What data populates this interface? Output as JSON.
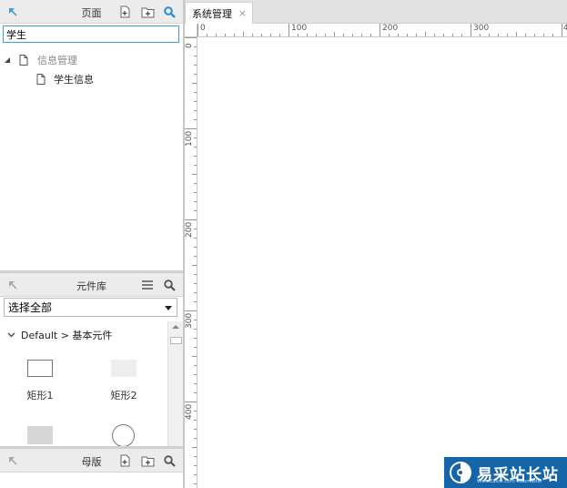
{
  "pages_panel": {
    "title": "页面",
    "search_value": "学生",
    "tree": [
      {
        "label": "信息管理",
        "type": "folder-page",
        "expanded": true
      },
      {
        "label": "学生信息",
        "type": "page"
      }
    ]
  },
  "library_panel": {
    "title": "元件库",
    "select_value": "选择全部",
    "group_label": "Default > 基本元件",
    "widgets": [
      {
        "label": "矩形1"
      },
      {
        "label": "矩形2"
      }
    ]
  },
  "masters_panel": {
    "title": "母版"
  },
  "tabs": [
    {
      "label": "系统管理",
      "close": "×"
    }
  ],
  "ruler": {
    "top": [
      "0",
      "100",
      "200",
      "300",
      "4"
    ],
    "left": [
      "0",
      "100",
      "200",
      "300",
      "400"
    ]
  },
  "watermark": {
    "text": "易采站长站",
    "sub": "Www.Easck.Com Webmaster"
  },
  "colors": {
    "accent": "#3b9ddd",
    "panel_header": "#ececec",
    "watermark_bg": "#1565a8"
  }
}
